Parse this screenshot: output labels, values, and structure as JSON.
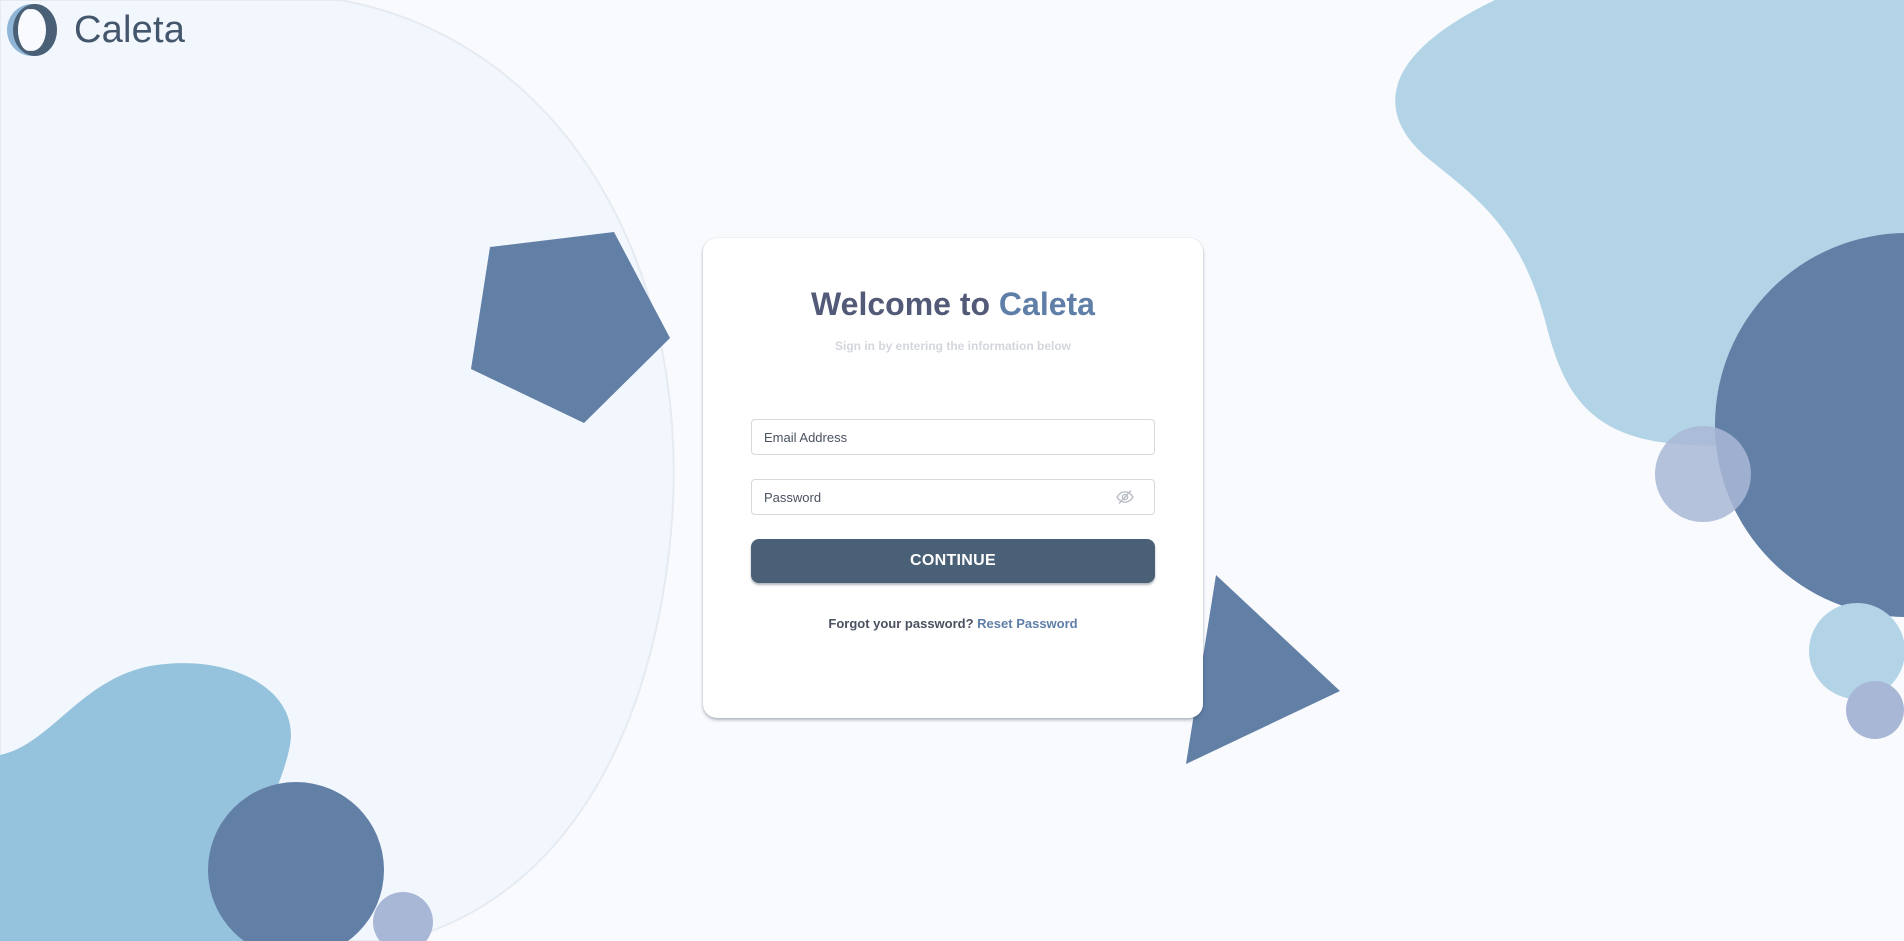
{
  "app": {
    "logo_text": "Caleta",
    "logo_icon": "caleta-logo-icon"
  },
  "login": {
    "title_prefix": "Welcome to ",
    "title_brand": "Caleta",
    "subtitle": "Sign in by entering the information below",
    "email": {
      "placeholder": "Email Address",
      "value": ""
    },
    "password": {
      "placeholder": "Password",
      "value": "",
      "toggle_icon": "eye-off-icon"
    },
    "continue_label": "CONTINUE",
    "forgot_text": "Forgot your password?",
    "reset_link": "Reset Password"
  },
  "colors": {
    "background": "#f8fafd",
    "primary_dark": "#4a6076",
    "brand_blue": "#5f7fa8",
    "title_text": "#525a78",
    "shape_dark": "#627fa6",
    "shape_light": "#b3d4e7",
    "shape_mid": "#95c2dc",
    "shape_lavender": "#a9b7d6"
  }
}
